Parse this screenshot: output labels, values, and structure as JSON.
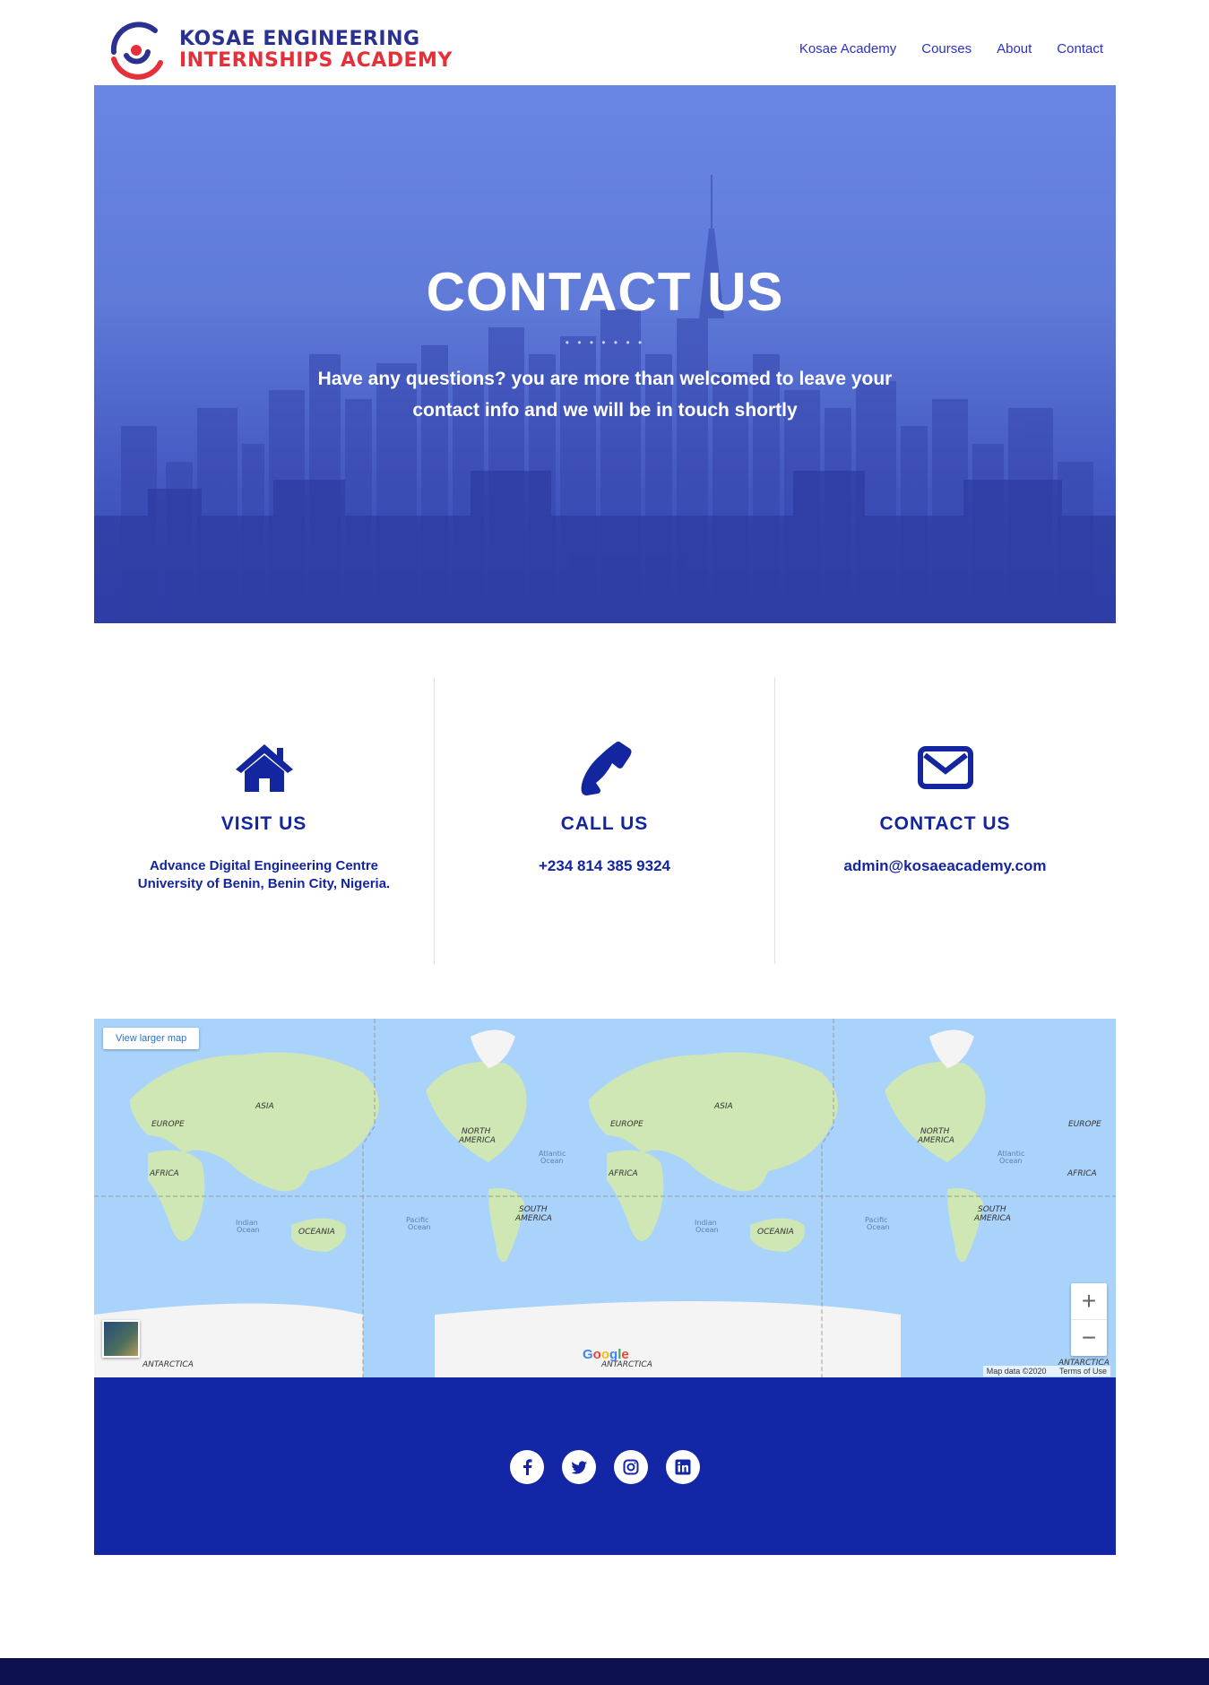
{
  "brand": {
    "line1": "KOSAE ENGINEERING",
    "line2": "INTERNSHIPS ACADEMY",
    "logo_icon": "target-logo-icon"
  },
  "nav": {
    "items": [
      "Kosae Academy",
      "Courses",
      "About",
      "Contact"
    ]
  },
  "hero": {
    "title": "CONTACT US",
    "dots": "• • • • • • •",
    "subtitle": "Have any questions? you are more than welcomed to leave your contact info and we will be in touch shortly"
  },
  "info": [
    {
      "icon": "home-icon",
      "title": "VISIT US",
      "line1": "Advance Digital Engineering Centre",
      "line2": "University of Benin, Benin City, Nigeria."
    },
    {
      "icon": "phone-icon",
      "title": "CALL US",
      "line1": "+234 814 385 9324"
    },
    {
      "icon": "envelope-icon",
      "title": "CONTACT US",
      "line1": "admin@kosaeacademy.com"
    }
  ],
  "map": {
    "larger": "View larger map",
    "zoom_in": "+",
    "zoom_out": "−",
    "data": "Map data ©2020",
    "terms": "Terms of Use",
    "google": "Google",
    "labels": [
      "ASIA",
      "EUROPE",
      "AFRICA",
      "OCEANIA",
      "NORTH AMERICA",
      "SOUTH AMERICA",
      "ANTARCTICA",
      "Indian Ocean",
      "Pacific Ocean",
      "Atlantic Ocean"
    ]
  },
  "social": [
    "facebook-icon",
    "twitter-icon",
    "instagram-icon",
    "linkedin-icon"
  ],
  "colors": {
    "primary": "#13259f",
    "accent": "#e5303a",
    "hero": "#6a86e4",
    "band": "#1326a6",
    "bottom": "#0d1150"
  }
}
